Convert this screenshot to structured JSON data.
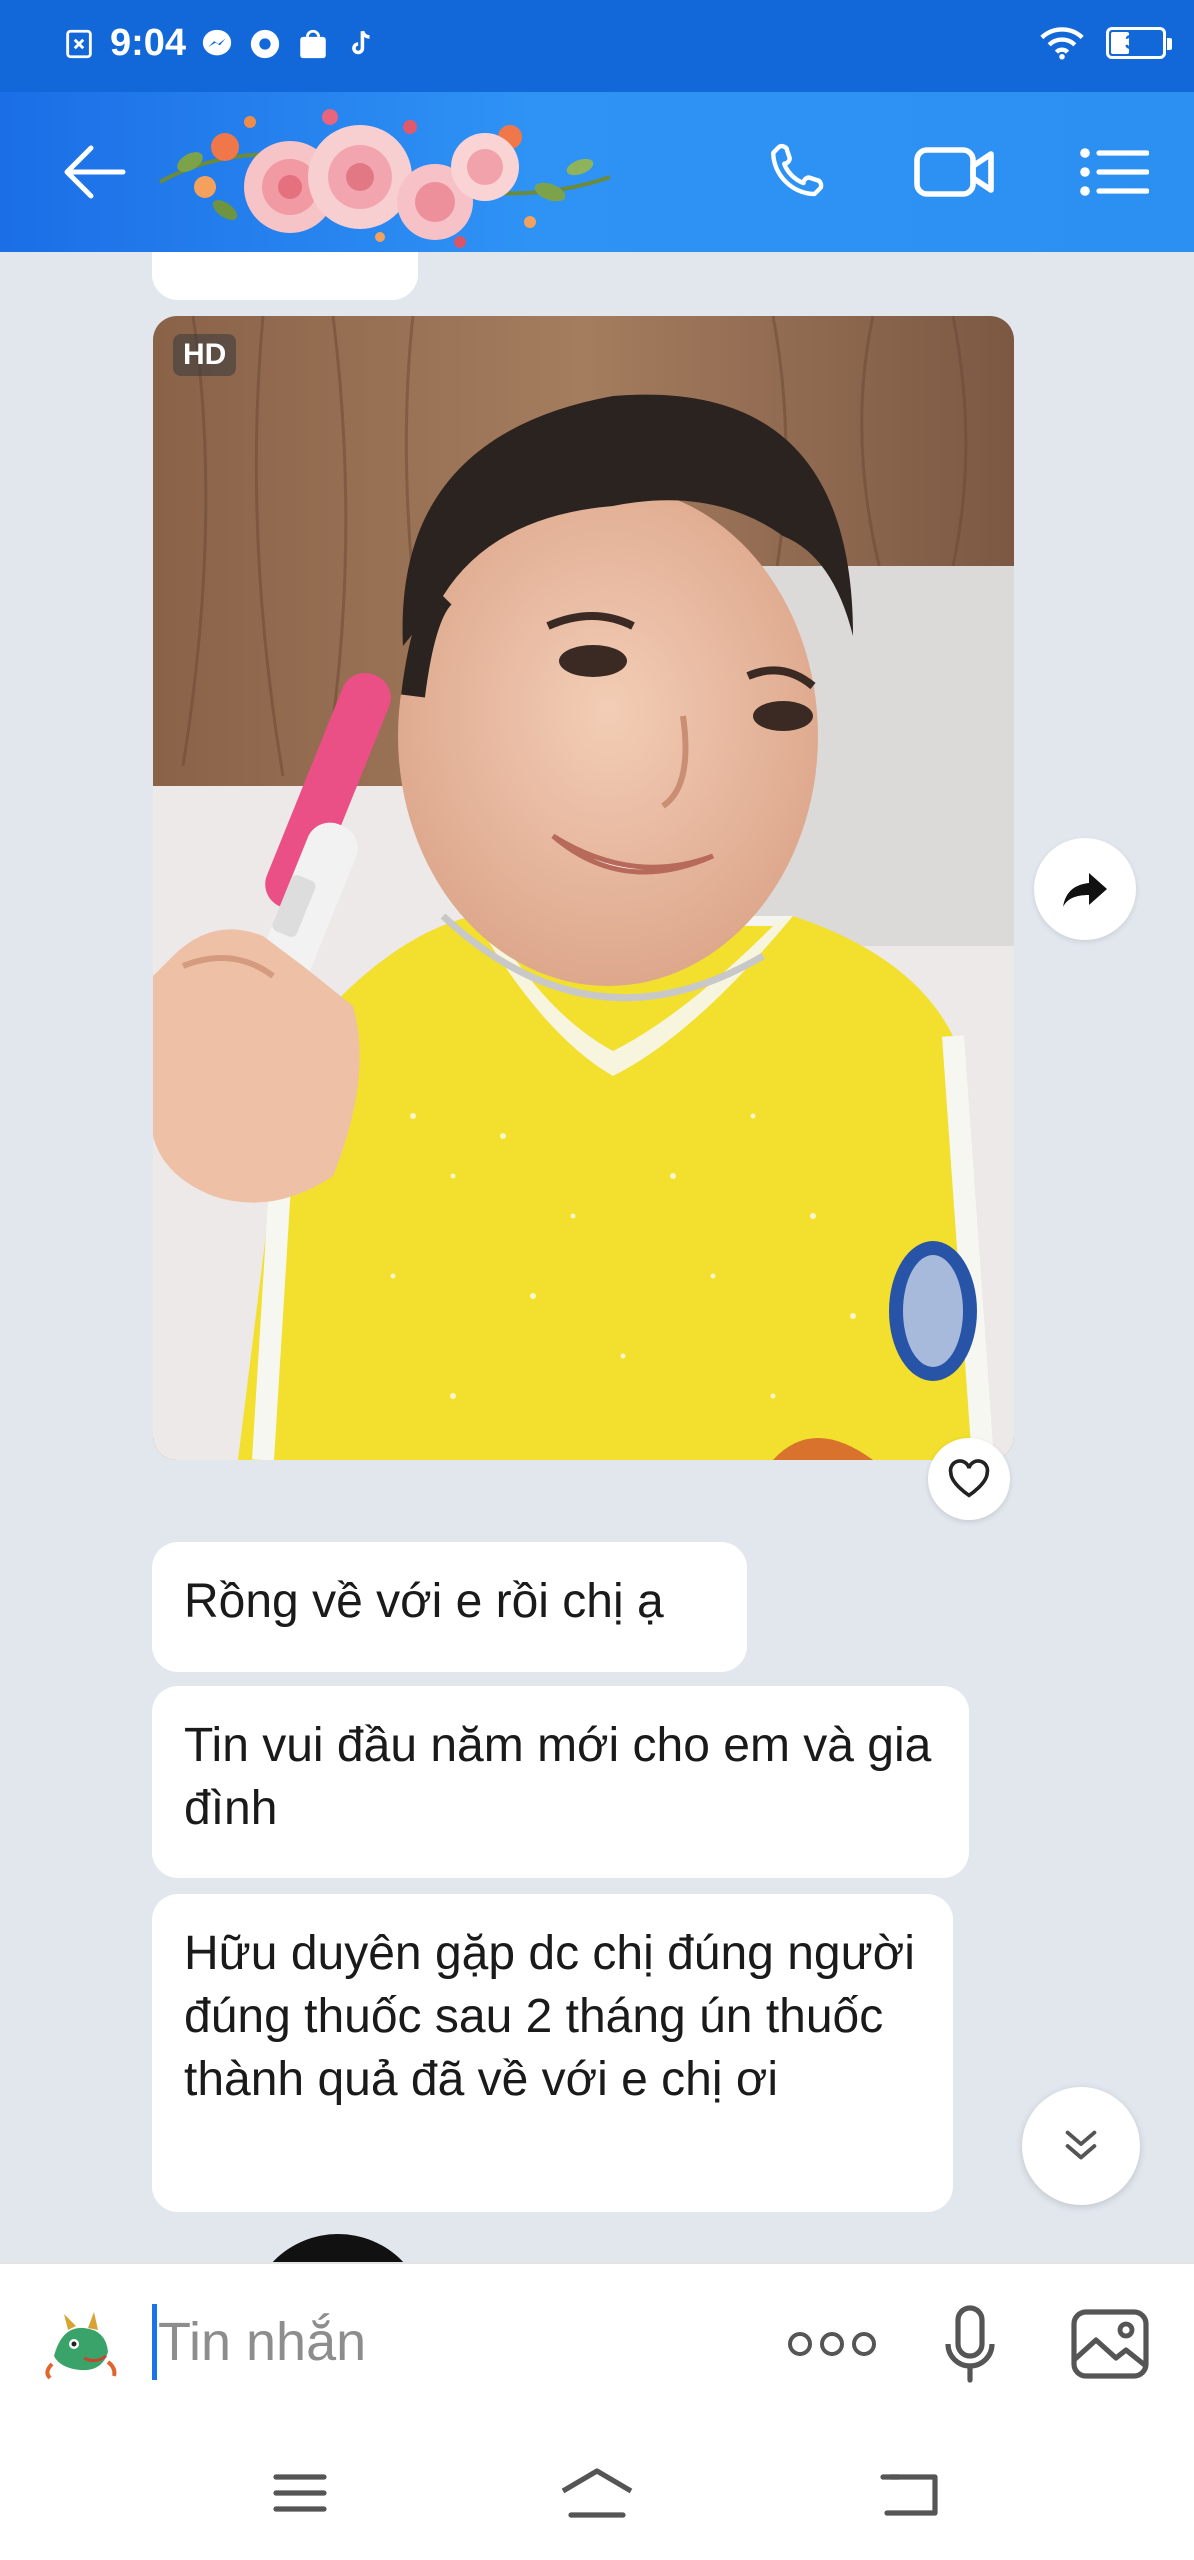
{
  "status_bar": {
    "time": "9:04",
    "battery": "34",
    "icons": [
      "sim-icon",
      "messenger-icon",
      "app-icon",
      "shop-icon",
      "tiktok-icon",
      "wifi-icon",
      "battery-icon"
    ]
  },
  "header": {
    "icons": [
      "back-arrow-icon",
      "flower-decoration",
      "phone-icon",
      "video-camera-icon",
      "list-menu-icon"
    ]
  },
  "photo": {
    "badge": "HD"
  },
  "messages": [
    {
      "text": "Rồng về với e rồi chị ạ"
    },
    {
      "text": "Tin vui đầu năm mới cho em và gia đình"
    },
    {
      "text": "Hữu duyên gặp dc chị đúng người đúng thuốc sau 2 tháng ún thuốc thành quả đã về với e chị ơi"
    }
  ],
  "input": {
    "placeholder": "Tin nhắn"
  },
  "colors": {
    "header_blue": "#2c8ff2",
    "status_blue": "#1268d8",
    "chat_bg": "#e2e7ee",
    "caret": "#1a73e8"
  }
}
